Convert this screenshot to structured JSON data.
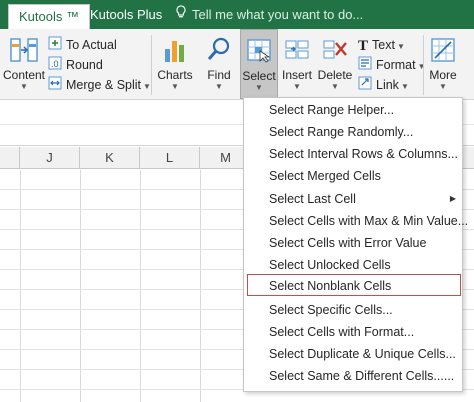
{
  "tabs": {
    "kutools": "Kutools ™",
    "kutools_plus": "Kutools Plus",
    "tell_me": "Tell me what you want to do..."
  },
  "ribbon": {
    "content": "Content",
    "to_actual": "To Actual",
    "round": "Round",
    "merge_split": "Merge & Split",
    "charts": "Charts",
    "find": "Find",
    "select": "Select",
    "insert": "Insert",
    "delete": "Delete",
    "text": "Text",
    "format": "Format",
    "link": "Link",
    "more": "More"
  },
  "columns": [
    "J",
    "K",
    "L",
    "M"
  ],
  "select_menu": {
    "items": [
      {
        "label": "Select Range Helper...",
        "submenu": false,
        "highlighted": false
      },
      {
        "label": "Select Range Randomly...",
        "submenu": false,
        "highlighted": false
      },
      {
        "label": "Select Interval Rows & Columns...",
        "submenu": false,
        "highlighted": false
      },
      {
        "label": "Select Merged Cells",
        "submenu": false,
        "highlighted": false
      },
      {
        "label": "Select Last Cell",
        "submenu": true,
        "highlighted": false
      },
      {
        "label": "Select Cells with Max & Min Value...",
        "submenu": false,
        "highlighted": false
      },
      {
        "label": "Select Cells with Error Value",
        "submenu": false,
        "highlighted": false
      },
      {
        "label": "Select Unlocked Cells",
        "submenu": false,
        "highlighted": false
      },
      {
        "label": "Select Nonblank Cells",
        "submenu": false,
        "highlighted": true
      },
      {
        "label": "Select Specific Cells...",
        "submenu": false,
        "highlighted": false
      },
      {
        "label": "Select Cells with Format...",
        "submenu": false,
        "highlighted": false
      },
      {
        "label": "Select Duplicate & Unique Cells...",
        "submenu": false,
        "highlighted": false
      },
      {
        "label": "Select Same & Different Cells......",
        "submenu": false,
        "highlighted": false
      }
    ]
  },
  "colors": {
    "excel_green": "#217346",
    "highlight_border": "#c0504d",
    "ribbon_bg": "#f3f3f3"
  },
  "icons": [
    "lightbulb-icon",
    "content-icon",
    "to-actual-icon",
    "round-icon",
    "merge-split-icon",
    "charts-icon",
    "find-icon",
    "select-icon",
    "insert-icon",
    "delete-icon",
    "text-icon",
    "format-icon",
    "link-icon",
    "more-icon",
    "submenu-arrow-icon"
  ]
}
